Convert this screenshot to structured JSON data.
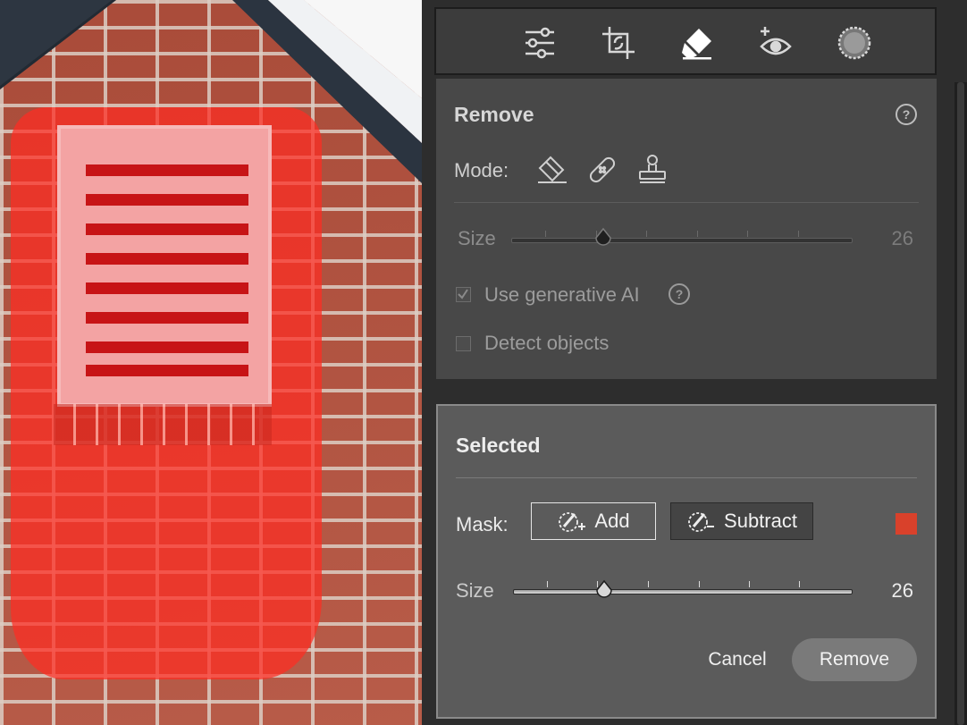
{
  "toolbar": {
    "icons": [
      "sliders-icon",
      "crop-icon",
      "eraser-icon",
      "redeye-icon",
      "masking-icon"
    ],
    "active": "eraser-icon"
  },
  "remove_panel": {
    "title": "Remove",
    "mode_label": "Mode:",
    "mode_icons": [
      "eraser-mode-icon",
      "heal-mode-icon",
      "clone-mode-icon"
    ],
    "size_label": "Size",
    "size_value": "26",
    "use_ai_label": "Use generative AI",
    "use_ai_checked": true,
    "detect_objects_label": "Detect objects",
    "detect_objects_checked": false,
    "size_level": 0.27
  },
  "selected_panel": {
    "title": "Selected",
    "mask_label": "Mask:",
    "add_label": "Add",
    "subtract_label": "Subtract",
    "mask_color": "#d9412b",
    "size_label": "Size",
    "size_value": "26",
    "size_level": 0.27,
    "cancel_label": "Cancel",
    "remove_label": "Remove"
  },
  "colors": {
    "mask_overlay": "#ff2d23",
    "brick": "#b4533f"
  }
}
